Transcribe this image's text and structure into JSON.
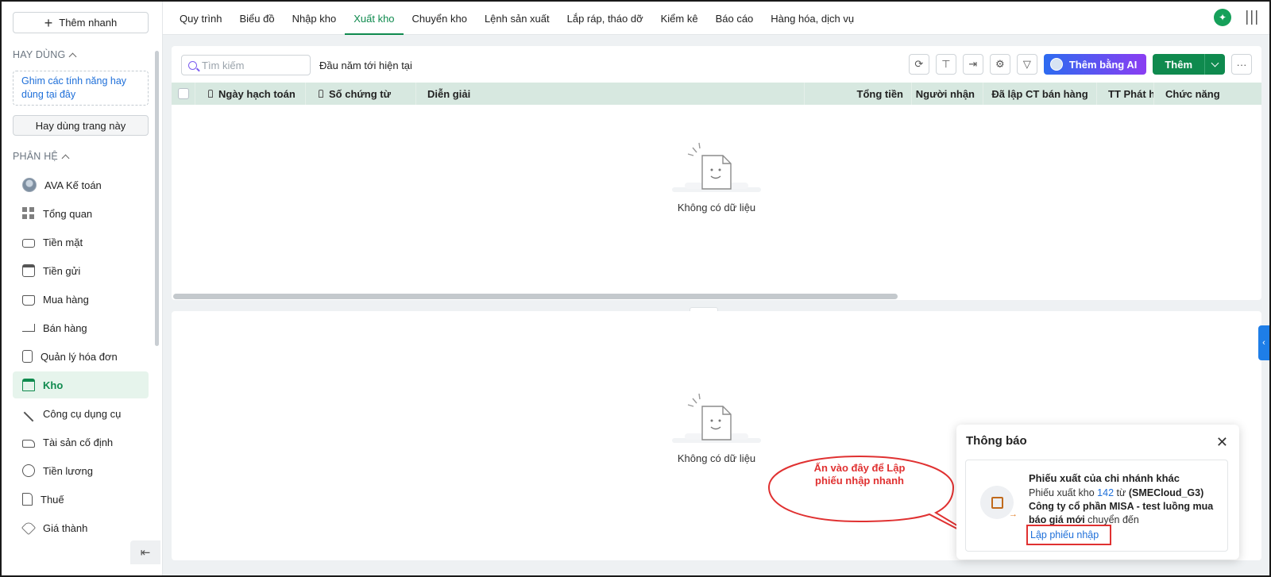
{
  "sidebar": {
    "quick_add": "Thêm nhanh",
    "favorites_header": "HAY DÙNG",
    "pin_hint": "Ghim các tính năng hay dùng tại đây",
    "favorite_page_button": "Hay dùng trang này",
    "modules_header": "PHÂN HỆ",
    "items": [
      {
        "label": "AVA Kế toán",
        "icon": "ava-avatar-icon"
      },
      {
        "label": "Tổng quan",
        "icon": "dashboard-icon"
      },
      {
        "label": "Tiền mặt",
        "icon": "cash-icon"
      },
      {
        "label": "Tiền gửi",
        "icon": "bank-icon"
      },
      {
        "label": "Mua hàng",
        "icon": "shopping-bag-icon"
      },
      {
        "label": "Bán hàng",
        "icon": "cart-icon"
      },
      {
        "label": "Quản lý hóa đơn",
        "icon": "invoice-icon"
      },
      {
        "label": "Kho",
        "icon": "warehouse-icon"
      },
      {
        "label": "Công cụ dụng cụ",
        "icon": "tools-icon"
      },
      {
        "label": "Tài sản cố định",
        "icon": "truck-icon"
      },
      {
        "label": "Tiền lương",
        "icon": "dollar-circle-icon"
      },
      {
        "label": "Thuế",
        "icon": "tax-document-icon"
      },
      {
        "label": "Giá thành",
        "icon": "price-tag-icon"
      }
    ],
    "active_item": "Kho"
  },
  "tabs": [
    "Quy trình",
    "Biểu đồ",
    "Nhập kho",
    "Xuất kho",
    "Chuyển kho",
    "Lệnh sản xuất",
    "Lắp ráp, tháo dỡ",
    "Kiểm kê",
    "Báo cáo",
    "Hàng hóa, dịch vụ"
  ],
  "active_tab": "Xuất kho",
  "toolbar": {
    "search_placeholder": "Tìm kiếm",
    "period": "Đầu năm tới hiện tại",
    "ai_button": "Thêm bằng AI",
    "add_button": "Thêm"
  },
  "table": {
    "columns": [
      "Ngày hạch toán",
      "Số chứng từ",
      "Diễn giải",
      "Tổng tiền",
      "Người nhận",
      "Đã lập CT bán hàng",
      "TT Phát hà",
      "Chức năng"
    ]
  },
  "empty_text": "Không có dữ liệu",
  "notification": {
    "title": "Thông báo",
    "heading": "Phiếu xuất của chi nhánh khác",
    "line1_prefix": "Phiếu xuất kho ",
    "line1_number": "142",
    "line1_mid": " từ ",
    "line1_branch": "(SMECloud_G3)",
    "company": "Công ty cổ phần MISA - test luồng mua báo giá mới",
    "transferred": " chuyển đến",
    "action_link": "Lập phiếu nhập"
  },
  "callout": {
    "text": "Ấn vào đây để Lập phiếu nhập nhanh",
    "color": "#e03131"
  },
  "colors": {
    "brand_green": "#0f8a4e",
    "table_header": "#d7e8e0",
    "link_blue": "#1e6fd9"
  }
}
